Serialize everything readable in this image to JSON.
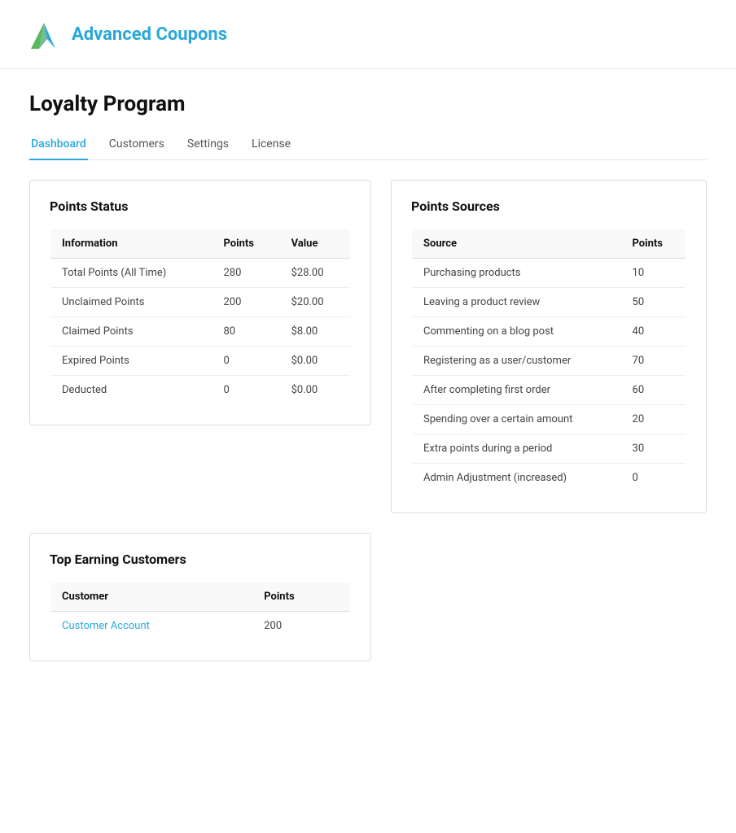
{
  "header": {
    "logo_text": "Advanced Coupons"
  },
  "page": {
    "title": "Loyalty Program"
  },
  "tabs": [
    {
      "id": "dashboard",
      "label": "Dashboard",
      "active": true
    },
    {
      "id": "customers",
      "label": "Customers",
      "active": false
    },
    {
      "id": "settings",
      "label": "Settings",
      "active": false
    },
    {
      "id": "license",
      "label": "License",
      "active": false
    }
  ],
  "points_status": {
    "title": "Points Status",
    "columns": {
      "information": "Information",
      "points": "Points",
      "value": "Value"
    },
    "rows": [
      {
        "information": "Total Points (All Time)",
        "points": "280",
        "value": "$28.00"
      },
      {
        "information": "Unclaimed Points",
        "points": "200",
        "value": "$20.00"
      },
      {
        "information": "Claimed Points",
        "points": "80",
        "value": "$8.00"
      },
      {
        "information": "Expired Points",
        "points": "0",
        "value": "$0.00"
      },
      {
        "information": "Deducted",
        "points": "0",
        "value": "$0.00"
      }
    ]
  },
  "points_sources": {
    "title": "Points Sources",
    "columns": {
      "source": "Source",
      "points": "Points"
    },
    "rows": [
      {
        "source": "Purchasing products",
        "points": "10"
      },
      {
        "source": "Leaving a product review",
        "points": "50"
      },
      {
        "source": "Commenting on a blog post",
        "points": "40"
      },
      {
        "source": "Registering as a user/customer",
        "points": "70"
      },
      {
        "source": "After completing first order",
        "points": "60"
      },
      {
        "source": "Spending over a certain amount",
        "points": "20"
      },
      {
        "source": "Extra points during a period",
        "points": "30"
      },
      {
        "source": "Admin Adjustment (increased)",
        "points": "0"
      }
    ]
  },
  "top_customers": {
    "title": "Top Earning Customers",
    "columns": {
      "customer": "Customer",
      "points": "Points"
    },
    "rows": [
      {
        "customer": "Customer Account",
        "points": "200",
        "is_link": true
      }
    ]
  }
}
